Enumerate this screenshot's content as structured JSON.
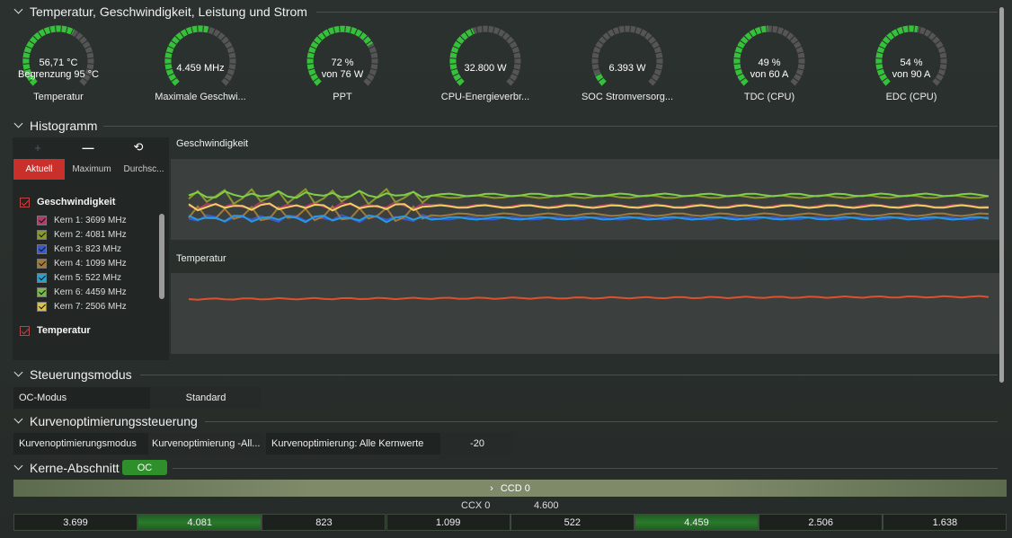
{
  "sections": {
    "temp_title": "Temperatur, Geschwindigkeit, Leistung und Strom",
    "histogram_title": "Histogramm",
    "control_title": "Steuerungsmodus",
    "curve_title": "Kurvenoptimierungssteuerung",
    "cores_title": "Kerne-Abschnitt"
  },
  "gauges": [
    {
      "line1": "56,71 °C",
      "line2": "Begrenzung 95 °C",
      "label": "Temperatur",
      "fraction": 0.6
    },
    {
      "line1": "4.459  MHz",
      "line2": "",
      "label": "Maximale Geschwi...",
      "fraction": 0.55
    },
    {
      "line1": "72 %",
      "line2": "von 76 W",
      "label": "PPT",
      "fraction": 0.72
    },
    {
      "line1": "32.800 W",
      "line2": "",
      "label": "CPU-Energieverbr...",
      "fraction": 0.42
    },
    {
      "line1": "6.393 W",
      "line2": "",
      "label": "SOC Stromversorg...",
      "fraction": 0.08
    },
    {
      "line1": "49 %",
      "line2": "von 60 A",
      "label": "TDC (CPU)",
      "fraction": 0.49
    },
    {
      "line1": "54 %",
      "line2": "von 90 A",
      "label": "EDC (CPU)",
      "fraction": 0.54
    }
  ],
  "histogram": {
    "toolbar": {
      "add_icon": "+",
      "minus_icon": "—",
      "reset_icon": "⟲"
    },
    "tabs": [
      "Aktuell",
      "Maximum",
      "Durchsc..."
    ],
    "active_tab": "Aktuell",
    "groups": {
      "speed": "Geschwindigkeit",
      "temp": "Temperatur"
    },
    "cores": [
      {
        "label": "Kern 1: 3699 MHz",
        "color": "#b03a6a"
      },
      {
        "label": "Kern 2: 4081 MHz",
        "color": "#8a9a2a"
      },
      {
        "label": "Kern 3: 823 MHz",
        "color": "#3a5acc"
      },
      {
        "label": "Kern 4: 1099 MHz",
        "color": "#a07a3a"
      },
      {
        "label": "Kern 5: 522 MHz",
        "color": "#2aa0d0"
      },
      {
        "label": "Kern 6: 4459 MHz",
        "color": "#7ab84a"
      },
      {
        "label": "Kern 7: 2506 MHz",
        "color": "#d8c050"
      }
    ],
    "chart_speed_title": "Geschwindigkeit",
    "chart_temp_title": "Temperatur"
  },
  "control": {
    "label": "OC-Modus",
    "value": "Standard"
  },
  "curve": {
    "mode_label": "Kurvenoptimierungsmodus",
    "mode_value": "Kurvenoptimierung -All...",
    "all_label": "Kurvenoptimierung: Alle Kernwerte",
    "all_value": "-20"
  },
  "cores_section": {
    "badge": "OC",
    "ccd": "CCD 0",
    "ccx": "CCX 0",
    "ccx_value": "4.600",
    "values": [
      "3.699",
      "4.081",
      "823",
      "1.099",
      "522",
      "4.459",
      "2.506",
      "1.638"
    ],
    "highlight": [
      false,
      true,
      false,
      false,
      false,
      true,
      false,
      false
    ]
  },
  "colors": {
    "accent_green": "#2f8f2a",
    "gauge_track": "#555",
    "gauge_fill": "#35c23a",
    "active_tab": "#c9302c"
  }
}
